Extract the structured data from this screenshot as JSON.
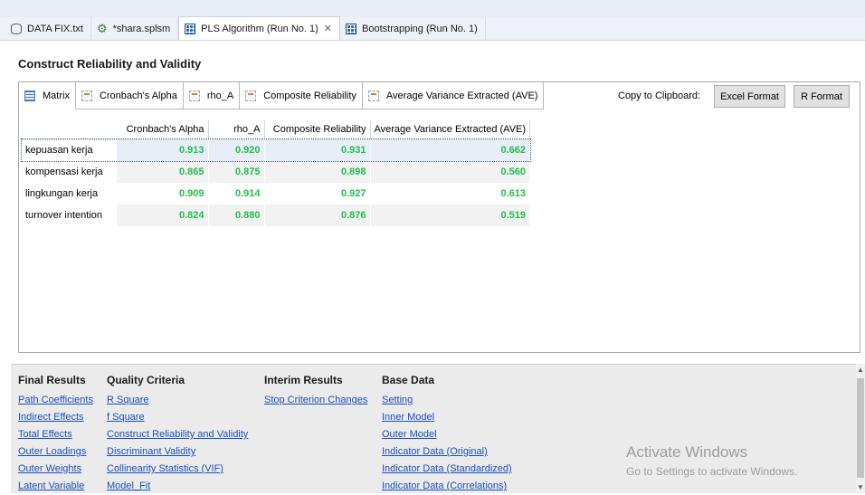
{
  "tabs": [
    {
      "label": "DATA FIX.txt",
      "icon": "database-icon"
    },
    {
      "label": "*shara.splsm",
      "icon": "model-icon"
    },
    {
      "label": "PLS Algorithm (Run No. 1)",
      "icon": "report-grid-icon",
      "active": true,
      "close": "✕"
    },
    {
      "label": "Bootstrapping (Run No. 1)",
      "icon": "report-grid-icon"
    }
  ],
  "section_title": "Construct Reliability and Validity",
  "subtabs": [
    {
      "label": "Matrix",
      "icon": "matrix-icon"
    },
    {
      "label": "Cronbach's Alpha",
      "icon": "table-icon"
    },
    {
      "label": "rho_A",
      "icon": "table-icon"
    },
    {
      "label": "Composite Reliability",
      "icon": "table-icon"
    },
    {
      "label": "Average Variance Extracted (AVE)",
      "icon": "table-icon"
    }
  ],
  "clipboard": {
    "label": "Copy to Clipboard:",
    "excel": "Excel Format",
    "r": "R Format"
  },
  "table": {
    "headers": [
      "Cronbach's Alpha",
      "rho_A",
      "Composite Reliability",
      "Average Variance Extracted (AVE)"
    ],
    "rows": [
      {
        "name": "kepuasan kerja",
        "values": [
          "0.913",
          "0.920",
          "0.931",
          "0.662"
        ]
      },
      {
        "name": "kompensasi kerja",
        "values": [
          "0.865",
          "0.875",
          "0.898",
          "0.560"
        ]
      },
      {
        "name": "lingkungan kerja",
        "values": [
          "0.909",
          "0.914",
          "0.927",
          "0.613"
        ]
      },
      {
        "name": "turnover intention",
        "values": [
          "0.824",
          "0.880",
          "0.876",
          "0.519"
        ]
      }
    ],
    "value_color": "#1fbf4a"
  },
  "bottom": {
    "final_results": {
      "title": "Final Results",
      "links": [
        "Path Coefficients",
        "Indirect Effects",
        "Total Effects",
        "Outer Loadings",
        "Outer Weights",
        "Latent Variable"
      ]
    },
    "quality_criteria": {
      "title": "Quality Criteria",
      "links": [
        "R Square",
        "f Square",
        "Construct Reliability and Validity",
        "Discriminant Validity",
        "Collinearity Statistics (VIF)",
        "Model_Fit"
      ]
    },
    "interim_results": {
      "title": "Interim Results",
      "links": [
        "Stop Criterion Changes"
      ]
    },
    "base_data": {
      "title": "Base Data",
      "links": [
        "Setting",
        "Inner Model",
        "Outer Model",
        "Indicator Data (Original)",
        "Indicator Data (Standardized)",
        "Indicator Data (Correlations)"
      ]
    }
  },
  "watermark": {
    "line1": "Activate Windows",
    "line2": "Go to Settings to activate Windows."
  }
}
